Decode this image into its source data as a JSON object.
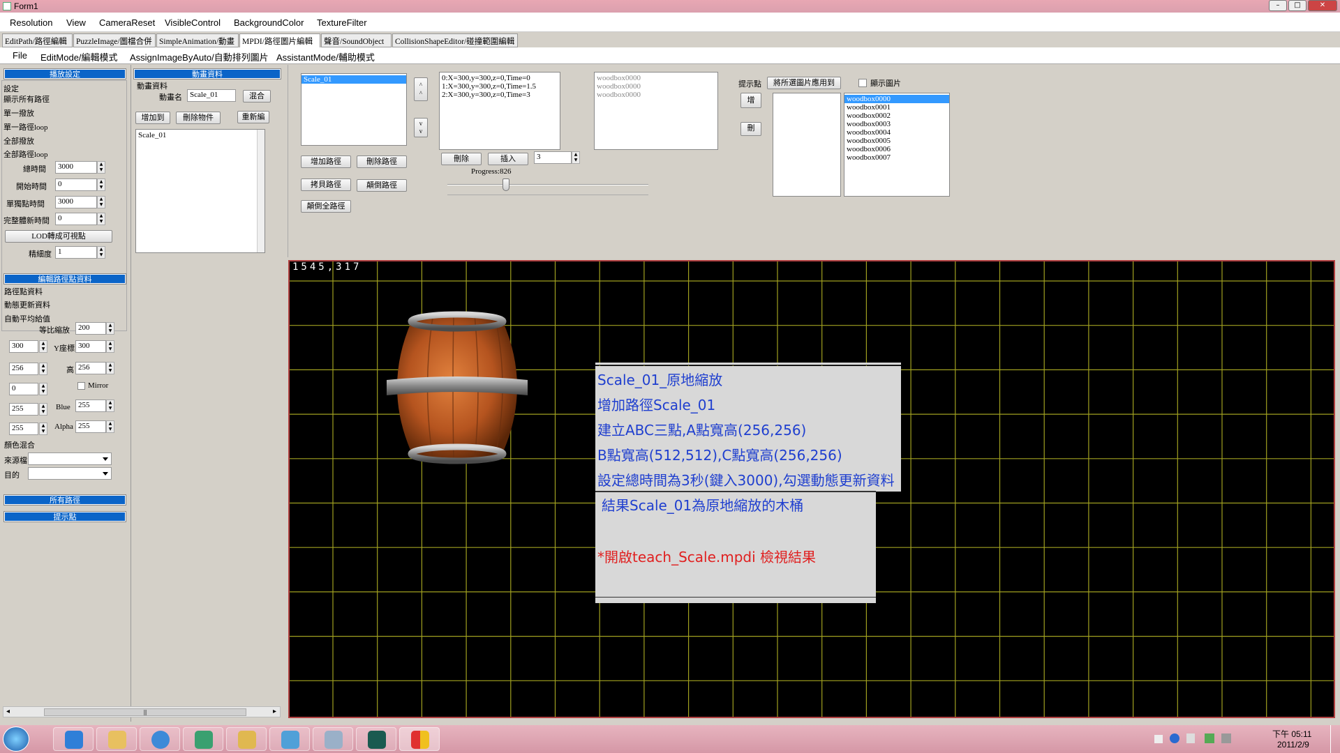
{
  "window": {
    "title": "Form1",
    "buttons": [
      "–",
      "□",
      "✕"
    ]
  },
  "menu": [
    "Resolution",
    "View",
    "CameraReset",
    "VisibleControl",
    "BackgroundColor",
    "TextureFilter"
  ],
  "tabs": [
    "EditPath/路徑編輯",
    "PuzzleImage/圖檔合併",
    "SimpleAnimation/動畫",
    "MPDI/路徑圖片編輯",
    "聲音/SoundObject",
    "CollisionShapeEditor/碰撞範圍編輯"
  ],
  "submenu": [
    "File",
    "EditMode/編輯模式",
    "AssignImageByAuto/自動排列圖片",
    "AssistantMode/輔助模式"
  ],
  "left": {
    "play_header": "播放設定",
    "play_rows": [
      "設定",
      "顯示所有路徑",
      "單一撥放",
      "單一路徑loop",
      "全部撥放",
      "全部路徑loop"
    ],
    "total_time_label": "總時間",
    "total_time": "3000",
    "start_time_label": "開始時間",
    "start_time": "0",
    "single_point_time_label": "單獨點時間",
    "single_point_time": "3000",
    "whole_update_label": "完整體新時間",
    "whole_update": "0",
    "lod_button": "LOD轉成可視點",
    "precision_label": "精細度",
    "precision": "1",
    "point_header": "編輯路徑點資料",
    "point_rows": [
      "路徑點資料",
      "動態更新資料",
      "自動平均給值"
    ],
    "scale_label": "等比縮放",
    "scale": "200",
    "x_val": "300",
    "y_label": "Y座標",
    "y_val": "300",
    "w_val": "256",
    "h_label": "高",
    "h_val": "256",
    "angle_val": "0",
    "mirror_label": "Mirror",
    "r_val": "255",
    "blue_label": "Blue",
    "blue_val": "255",
    "g_val": "255",
    "alpha_label": "Alpha",
    "alpha_val": "255",
    "blend_label": "顏色混合",
    "src_label": "來源檔",
    "dst_label": "目的",
    "all_paths_header": "所有路徑",
    "hint_header": "提示點",
    "scroll_mid": "|||"
  },
  "anim": {
    "header": "動畫資料",
    "group_label": "動畫資料",
    "name_label": "動畫名",
    "name_value": "Scale_01",
    "mix_button": "混合",
    "add_button": "增加到",
    "delete_button": "刪除物件",
    "rename_button": "重新編",
    "list": [
      "Scale_01"
    ]
  },
  "paths": {
    "list": [
      "Scale_01"
    ],
    "up_button": "^\n^",
    "down_button": "v\nv",
    "add_path": "增加路徑",
    "delete_path": "刪除路徑",
    "copy_path": "拷貝路徑",
    "reverse_path": "顛倒路徑",
    "reverse_all": "顛倒全路徑",
    "points": [
      "0:X=300,y=300,z=0,Time=0",
      "1:X=300,y=300,z=0,Time=1.5",
      "2:X=300,y=300,z=0,Time=3"
    ],
    "del_point": "刪除",
    "insert_point": "插入",
    "insert_index": "3",
    "progress_label": "Progress:826",
    "progress_fraction": 0.29,
    "images_used": [
      "woodbox0000",
      "woodbox0000",
      "woodbox0000"
    ]
  },
  "hint": {
    "label": "提示點",
    "apply_button": "將所選圖片應用到",
    "show_label": "顯示圖片",
    "add_button": "增",
    "del_button": "刪",
    "images": [
      "woodbox0000",
      "woodbox0001",
      "woodbox0002",
      "woodbox0003",
      "woodbox0004",
      "woodbox0005",
      "woodbox0006",
      "woodbox0007"
    ]
  },
  "canvas": {
    "coords": "1545,317",
    "note_lines": [
      "Scale_01_原地縮放",
      "增加路徑Scale_01",
      "建立ABC三點,A點寬高(256,256)",
      "B點寬高(512,512),C點寬高(256,256)",
      "設定總時間為3秒(鍵入3000),勾選動態更新資料"
    ],
    "result_line": "結果Scale_01為原地縮放的木桶",
    "open_line": "*開啟teach_Scale.mpdi 檢視結果",
    "colors": {
      "bg": "#000000",
      "grid": "#a0a020",
      "note_text": "#1f3fcf",
      "red_text": "#e02020"
    }
  },
  "taskbar": {
    "time": "下午 05:11",
    "date": "2011/2/9"
  }
}
